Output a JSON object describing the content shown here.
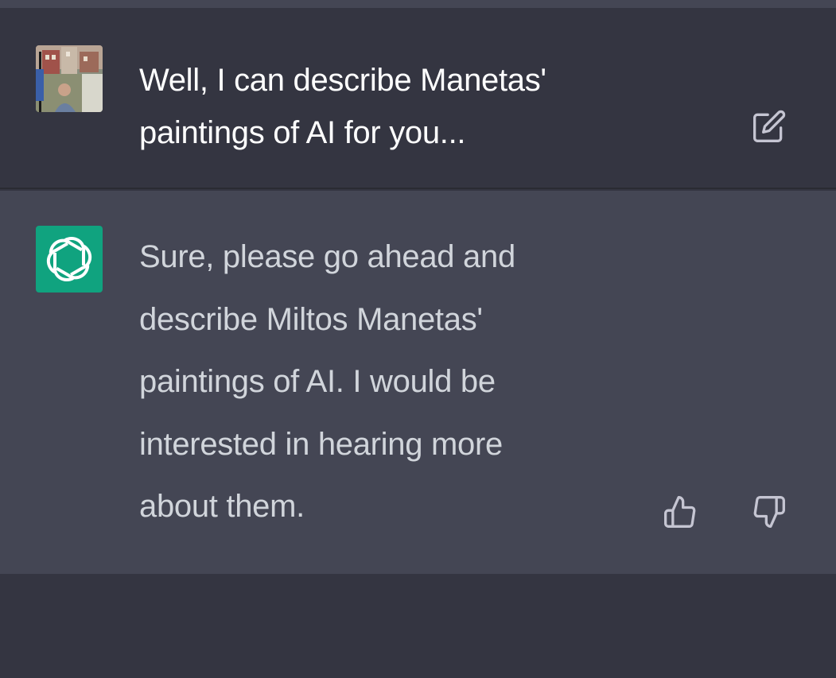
{
  "conversation": {
    "user_message": {
      "text": "Well, I can describe Manetas' paintings of AI for you...",
      "avatar_icon": "user-avatar-photo",
      "edit_icon": "edit-icon"
    },
    "assistant_message": {
      "text": "Sure, please go ahead and describe Miltos Manetas' paintings of AI. I would be interested in hearing more about them.",
      "avatar_icon": "openai-logo-icon",
      "thumbs_up_icon": "thumbs-up-icon",
      "thumbs_down_icon": "thumbs-down-icon"
    }
  },
  "colors": {
    "background": "#343541",
    "assistant_background": "#444654",
    "assistant_avatar": "#10a37f",
    "user_text": "#ffffff",
    "assistant_text": "#d1d5db",
    "icon_color": "#c5c5d2"
  }
}
